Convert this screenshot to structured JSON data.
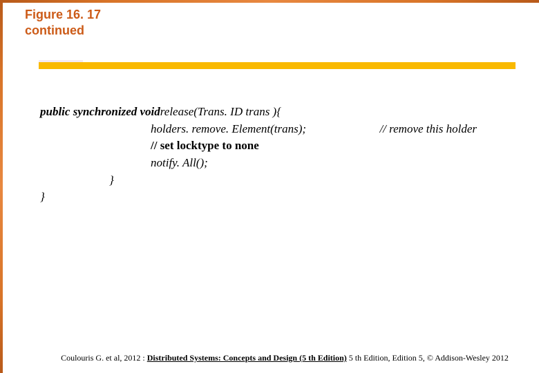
{
  "title": {
    "line1": "Figure 16. 17",
    "line2": "continued"
  },
  "code": {
    "l1_kw": "public synchronized void ",
    "l1_rest": "release(Trans. ID trans ){",
    "l2": "holders. remove. Element(trans);",
    "l2_comment": "// remove this holder",
    "l3": "// set locktype to none",
    "l4": "notify. All();",
    "l5": "}",
    "l6": "}"
  },
  "footer": {
    "prefix": "Coulouris G. et al, 2012 : ",
    "title_text": "Distributed Systems: Concepts and Design (5 th Edition)",
    "suffix": " 5 th Edition, Edition 5, © Addison-Wesley 2012"
  }
}
